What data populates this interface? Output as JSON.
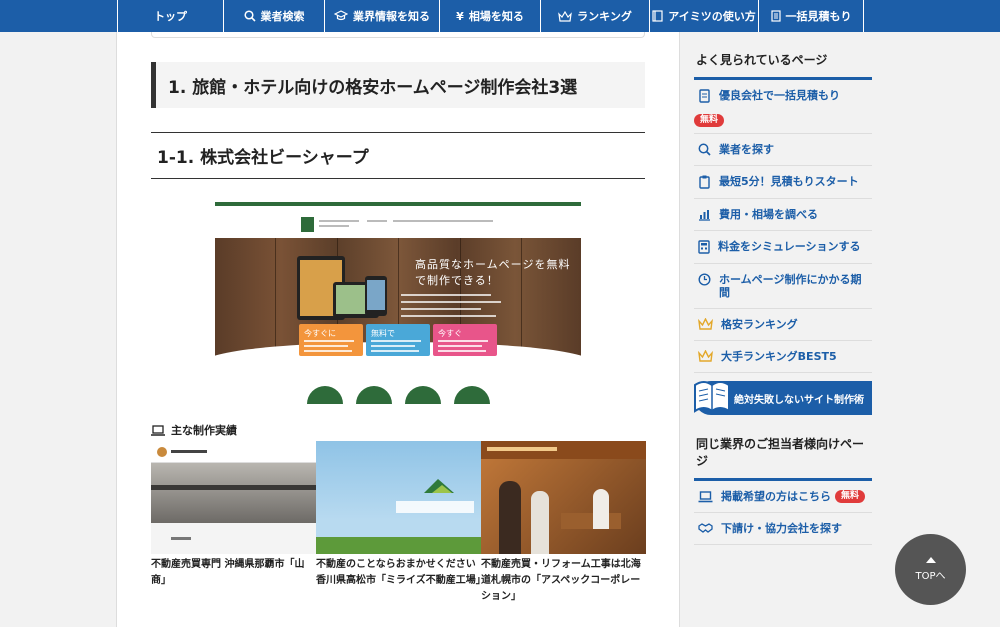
{
  "nav": {
    "items": [
      {
        "label": "トップ",
        "icon": "none"
      },
      {
        "label": "業者検索",
        "icon": "search-icon"
      },
      {
        "label": "業界情報を知る",
        "icon": "graduation-cap-icon"
      },
      {
        "label": "相場を知る",
        "icon": "yen-icon"
      },
      {
        "label": "ランキング",
        "icon": "crown-icon"
      },
      {
        "label": "アイミツの使い方",
        "icon": "book-icon"
      },
      {
        "label": "一括見積もり",
        "icon": "document-icon"
      }
    ]
  },
  "main": {
    "h2": "1. 旅館・ホテル向けの格安ホームページ制作会社3選",
    "h3": "1-1. 株式会社ビーシャープ",
    "hero_title": "高品質なホームページを無料で制作できる！",
    "cta": [
      "今すぐに",
      "無料で",
      "今すぐ"
    ],
    "works_title": "主な制作実績",
    "works": [
      {
        "caption": "不動産売買専門 沖縄県那覇市「山商」"
      },
      {
        "caption": "不動産のことならおまかせください 香川県高松市「ミライズ不動産工場」"
      },
      {
        "caption": "不動産売買・リフォーム工事は北海道札幌市の「アスペックコーポレーション」"
      }
    ]
  },
  "sidebar": {
    "heading1": "よく見られているページ",
    "items1": [
      {
        "label": "優良会社で一括見積もり",
        "icon": "document-icon"
      },
      {
        "label": "業者を探す",
        "icon": "search-icon"
      },
      {
        "label": "最短5分！見積もりスタート",
        "icon": "clipboard-icon"
      },
      {
        "label": "費用・相場を調べる",
        "icon": "bar-chart-icon"
      },
      {
        "label": "料金をシミュレーションする",
        "icon": "calculator-icon"
      },
      {
        "label": "ホームページ制作にかかる期間",
        "icon": "clock-icon"
      },
      {
        "label": "格安ランキング",
        "icon": "crown-icon"
      },
      {
        "label": "大手ランキングBEST5",
        "icon": "crown-icon"
      }
    ],
    "badge": "無料",
    "banner": "絶対失敗しないサイト制作術",
    "heading2": "同じ業界のご担当者様向けページ",
    "items2": [
      {
        "label": "掲載希望の方はこちら",
        "icon": "laptop-icon",
        "badge": "無料"
      },
      {
        "label": "下請け・協力会社を探す",
        "icon": "handshake-icon"
      }
    ]
  },
  "top_button": "TOPへ",
  "colors": {
    "primary": "#1c5ea8",
    "badge": "#e03b3b",
    "green": "#2e6b3a"
  }
}
